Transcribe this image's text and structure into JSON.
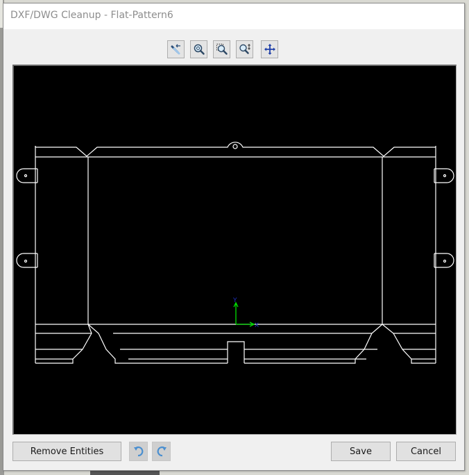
{
  "window": {
    "title": "DXF/DWG Cleanup - Flat-Pattern6"
  },
  "toolbar": {
    "buttons": [
      {
        "name": "select-entities",
        "icon": "select-arrow-icon"
      },
      {
        "name": "zoom-to-fit",
        "icon": "zoom-fit-icon"
      },
      {
        "name": "zoom-to-area",
        "icon": "zoom-area-icon"
      },
      {
        "name": "zoom-in-out",
        "icon": "zoom-in-out-icon"
      },
      {
        "name": "pan",
        "icon": "pan-icon"
      }
    ]
  },
  "viewport": {
    "background": "#000000",
    "line_color": "#ffffff",
    "axis": {
      "x_label": "X",
      "y_label": "Y",
      "arrow_color": "#00e000",
      "label_color": "#2030c0"
    }
  },
  "footer": {
    "remove_entities_label": "Remove Entities",
    "undo_icon": "undo-icon",
    "redo_icon": "redo-icon",
    "save_label": "Save",
    "cancel_label": "Cancel"
  }
}
